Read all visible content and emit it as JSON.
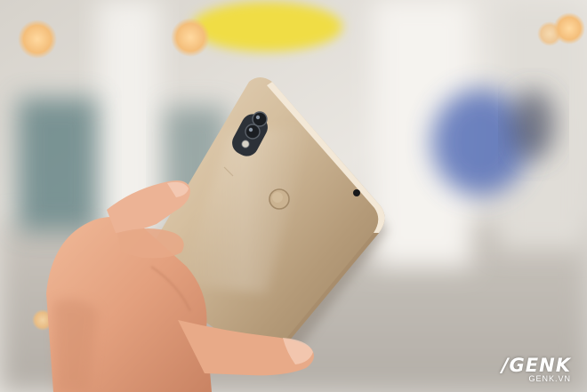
{
  "photo": {
    "subject": "gold-smartphone-rear",
    "colors": {
      "phone_body": "#d8c2a3",
      "phone_edge": "#eee2cf",
      "camera_module": "#2c3138",
      "skin": "#e6a887",
      "background_light": "#ece9e4",
      "bokeh_yellow": "#f0dd45",
      "bokeh_blue": "#5770b8"
    }
  },
  "watermark": {
    "logo_text": "/GENK",
    "domain_text": "GENK.VN"
  }
}
